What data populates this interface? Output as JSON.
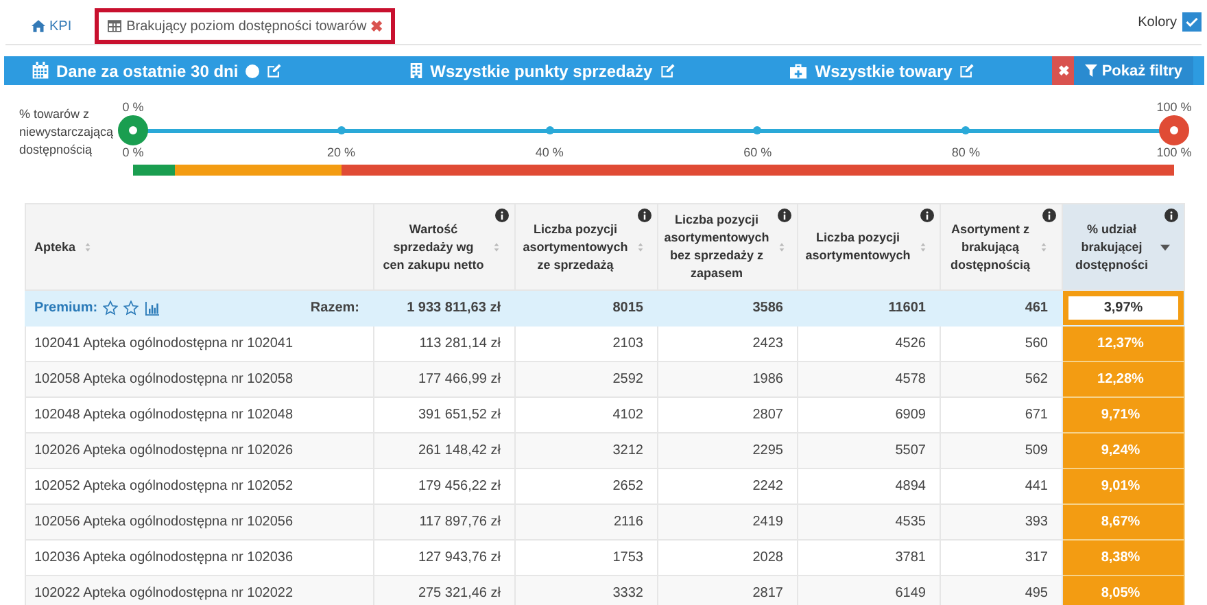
{
  "tabs": [
    {
      "label": "KPI",
      "selected": false
    },
    {
      "label": "Brakujący poziom dostępności towarów",
      "selected": true,
      "close": "✖"
    }
  ],
  "colors_toggle": {
    "label": "Kolory",
    "checked": true
  },
  "filter_bar": {
    "items": [
      {
        "label": "Dane za ostatnie 30 dni",
        "info": true
      },
      {
        "label": "Wszystkie punkty sprzedaży",
        "info": false
      },
      {
        "label": "Wszystkie towary",
        "info": false
      }
    ],
    "clear_button": "✖",
    "filters_button": "Pokaż filtry"
  },
  "range": {
    "label": "% towarów z niewystarczającą dostępnością",
    "handles": [
      {
        "label": "0 %",
        "level": 0,
        "color": "#1a9e50"
      },
      {
        "label": "100 %",
        "level": 1,
        "color": "#e04b35"
      }
    ],
    "ticks": [
      "0 %",
      "20 %",
      "40 %",
      "60 %",
      "80 %",
      "100 %"
    ]
  },
  "table": {
    "columns": [
      {
        "label": "Apteka",
        "info": false,
        "sorted": false
      },
      {
        "label": "Wartość sprzedaży wg cen zakupu netto",
        "info": true,
        "sorted": false
      },
      {
        "label": "Liczba pozycji asortymentowych ze sprzedażą",
        "info": true,
        "sorted": false
      },
      {
        "label": "Liczba pozycji asortymentowych bez sprzedaży z zapasem",
        "info": true,
        "sorted": false
      },
      {
        "label": "Liczba pozycji asortymentowych",
        "info": true,
        "sorted": false
      },
      {
        "label": "Asortyment z brakującą dostępnością",
        "info": true,
        "sorted": false
      },
      {
        "label": "% udział brakującej dostępności",
        "info": true,
        "sorted": true
      }
    ],
    "summary": {
      "premium_label": "Premium:",
      "total_label": "Razem:",
      "cells": [
        "1 933 811,63 zł",
        "8015",
        "3586",
        "11601",
        "461",
        "3,97%"
      ],
      "color": "#f39c12"
    },
    "rows": [
      {
        "cells": [
          "102041 Apteka ogólnodostępna nr 102041",
          "113 281,14 zł",
          "2103",
          "2423",
          "4526",
          "560",
          "12,37%"
        ],
        "color": "#f39c12"
      },
      {
        "cells": [
          "102058 Apteka ogólnodostępna nr 102058",
          "177 466,99 zł",
          "2592",
          "1986",
          "4578",
          "562",
          "12,28%"
        ],
        "color": "#f39c12"
      },
      {
        "cells": [
          "102048 Apteka ogólnodostępna nr 102048",
          "391 651,52 zł",
          "4102",
          "2807",
          "6909",
          "671",
          "9,71%"
        ],
        "color": "#f39c12"
      },
      {
        "cells": [
          "102026 Apteka ogólnodostępna nr 102026",
          "261 148,42 zł",
          "3212",
          "2295",
          "5507",
          "509",
          "9,24%"
        ],
        "color": "#f39c12"
      },
      {
        "cells": [
          "102052 Apteka ogólnodostępna nr 102052",
          "179 456,22 zł",
          "2652",
          "2242",
          "4894",
          "441",
          "9,01%"
        ],
        "color": "#f39c12"
      },
      {
        "cells": [
          "102056 Apteka ogólnodostępna nr 102056",
          "117 897,76 zł",
          "2116",
          "2419",
          "4535",
          "393",
          "8,67%"
        ],
        "color": "#f39c12"
      },
      {
        "cells": [
          "102036 Apteka ogólnodostępna nr 102036",
          "127 943,76 zł",
          "1753",
          "2028",
          "3781",
          "317",
          "8,38%"
        ],
        "color": "#f39c12"
      },
      {
        "cells": [
          "102022 Apteka ogólnodostępna nr 102022",
          "275 321,46 zł",
          "3332",
          "2817",
          "6149",
          "495",
          "8,05%"
        ],
        "color": "#f39c12"
      }
    ]
  }
}
